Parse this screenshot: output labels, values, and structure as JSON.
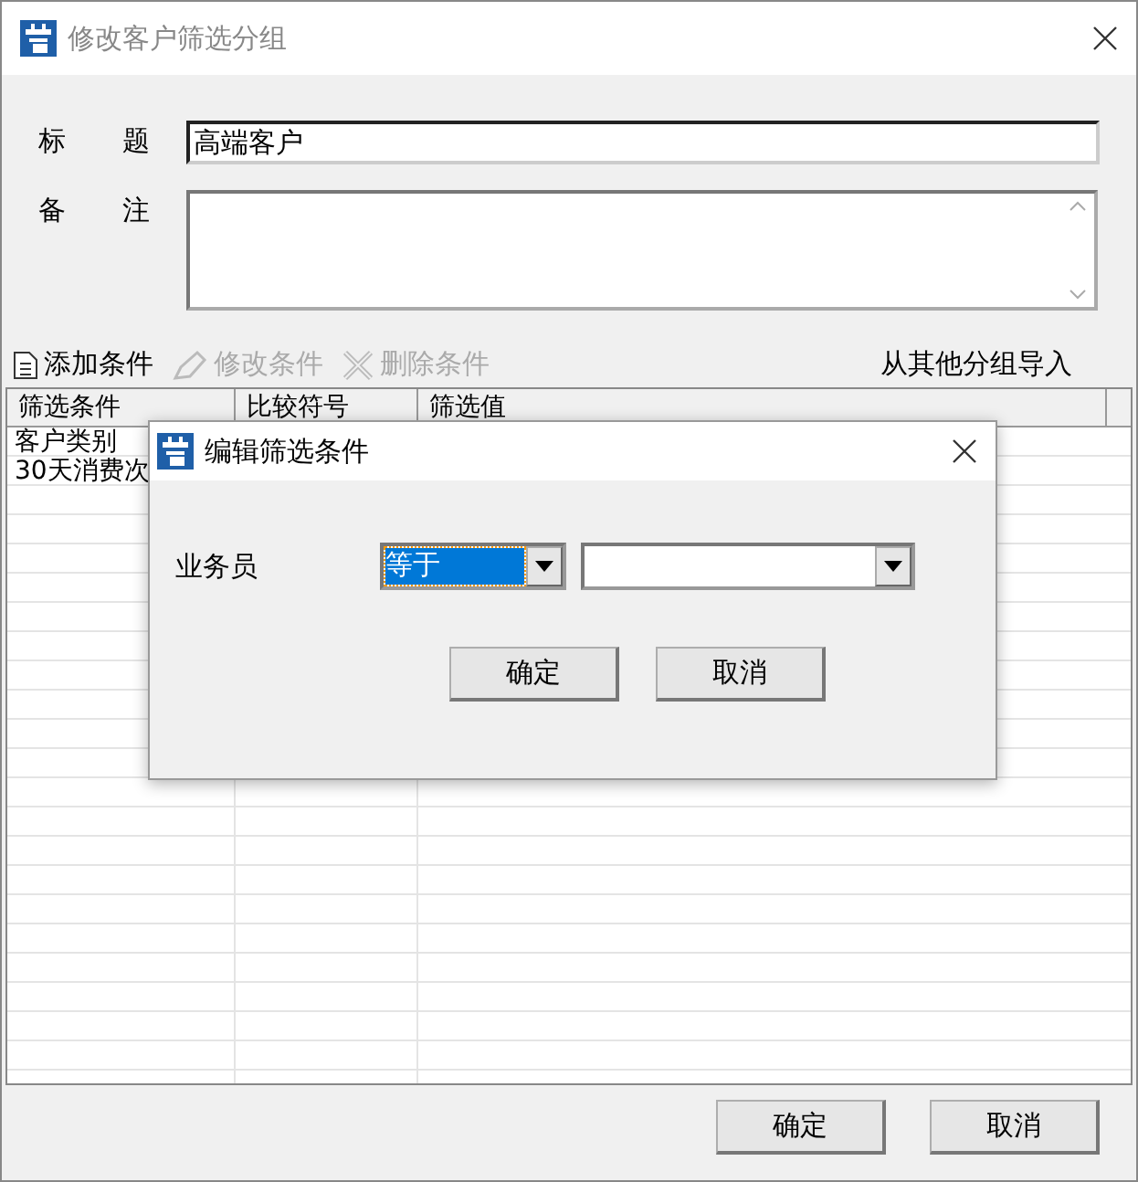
{
  "window": {
    "title": "修改客户筛选分组"
  },
  "fields": [
    {
      "label": "标 题",
      "value": "高端客户",
      "kind": "line"
    },
    {
      "label": "备 注",
      "kind": "memo"
    }
  ],
  "toolbar": [
    {
      "label": "添加条件",
      "disabled": false
    },
    {
      "label": "修改条件",
      "disabled": true
    },
    {
      "label": "删除条件",
      "disabled": true
    }
  ],
  "import_link": "从其他分组导入",
  "table": {
    "columns": [
      "筛选条件",
      "比较符号",
      "筛选值"
    ],
    "rows": [
      [
        "客户类别"
      ],
      [
        "30天消费次"
      ]
    ]
  },
  "buttons": [
    "确定",
    "取消"
  ],
  "dialog": {
    "title": "编辑筛选条件",
    "label": "业务员",
    "operator": {
      "value": "等于",
      "focused": true
    },
    "buttons": [
      "确定",
      "取消"
    ]
  }
}
